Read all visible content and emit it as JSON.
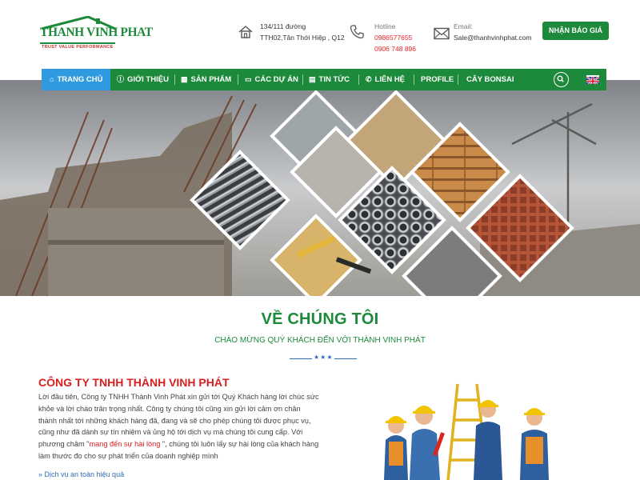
{
  "header": {
    "logo_text": "THANH VINH PHAT",
    "logo_tagline": "TRUST VALUE PERFORMANCE",
    "address_line1": "134/111 đường",
    "address_line2": "TTH02,Tân Thới Hiệp , Q12",
    "hotline_label": "Hotline",
    "hotline_1": "0986577655",
    "hotline_2": "0906 748 896",
    "email_label": "Email:",
    "email_value": "Sale@thanhvinhphat.com",
    "quote_button": "NHẬN BÁO GIÁ"
  },
  "nav": {
    "items": [
      {
        "label": "TRANG CHỦ",
        "icon": "home-icon"
      },
      {
        "label": "GIỚI THIỆU",
        "icon": "info-icon"
      },
      {
        "label": "SẢN PHẨM",
        "icon": "grid-icon"
      },
      {
        "label": "CÁC DỰ ÁN",
        "icon": "id-card-icon"
      },
      {
        "label": "TIN TỨC",
        "icon": "calendar-icon"
      },
      {
        "label": "LIÊN HỆ",
        "icon": "phone-icon"
      },
      {
        "label": "PROFILE",
        "icon": ""
      },
      {
        "label": "CÂY BONSAI",
        "icon": ""
      }
    ],
    "search_icon": "search-icon",
    "language_icon": "uk-flag-icon"
  },
  "about": {
    "title": "VỀ CHÚNG TÔI",
    "subtitle": "CHÀO MỪNG QUÝ KHÁCH ĐẾN VỚI THÀNH VINH PHÁT",
    "divider_stars": "★★★",
    "company_name": "CÔNG TY TNHH THÀNH VINH PHÁT",
    "paragraph_before": "Lời đầu tiên, Công ty TNHH Thành Vinh Phát xin gửi tới Quý Khách hàng lời chúc sức khỏe và lời chào trân trọng nhất. Công ty chúng tôi cũng xin gửi lời cảm ơn chân thành nhất tới những khách hàng đã, đang và sẽ cho phép chúng tôi được phục vụ, cũng như đã dành sự tín nhiệm và ủng hộ tới dịch vụ mà chúng tôi cung cấp. Với phương châm \"",
    "paragraph_highlight": "mang đến sự hài lòng",
    "paragraph_after": " \", chúng tôi luôn lấy sự hài lòng của khách hàng làm thước đo cho sự phát triển của doanh nghiệp mình",
    "link_text": "» Dịch vụ an toàn hiệu quả"
  },
  "colors": {
    "brand_green": "#1c8a3a",
    "active_nav_blue": "#2f9ae0",
    "accent_red": "#d62020",
    "link_blue": "#2f6eb5"
  }
}
